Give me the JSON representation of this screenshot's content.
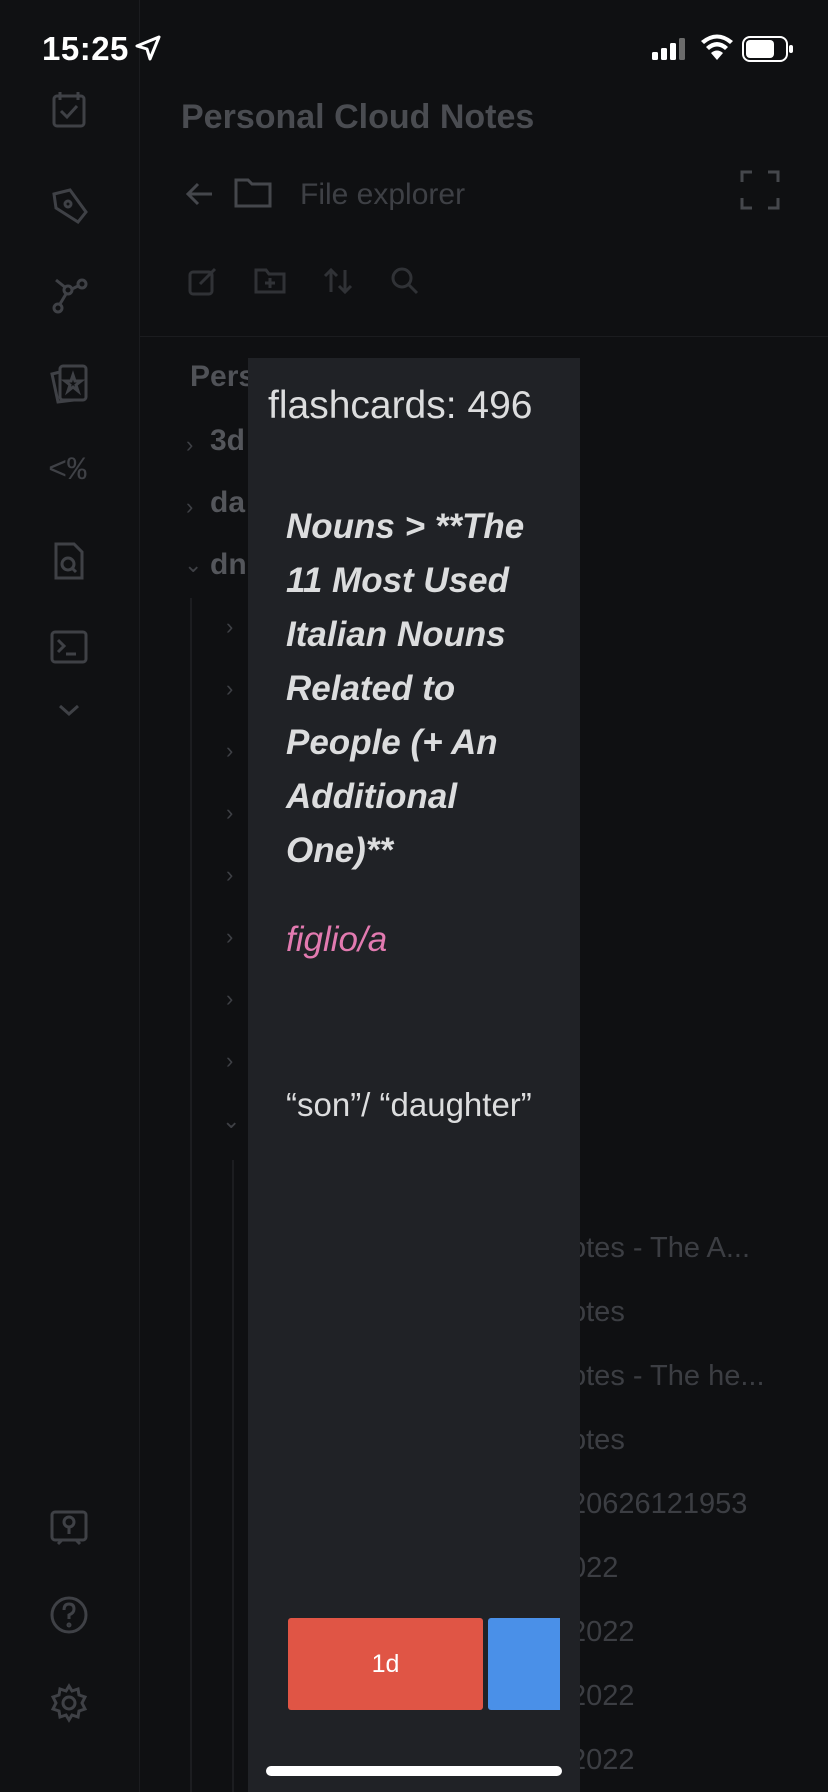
{
  "status_bar": {
    "time": "15:25"
  },
  "explorer": {
    "vault_title": "Personal Cloud Notes",
    "nav_label": "File explorer",
    "tree_root": "Pers",
    "tree_items": [
      "3d",
      "da",
      "dn"
    ],
    "file_rows": [
      "otes - The A...",
      "otes",
      "otes - The he...",
      "otes",
      "20626121953",
      "022",
      "2022",
      "2022",
      "2022"
    ]
  },
  "modal": {
    "title": "flashcards: 496",
    "question": "Nouns > **The 11 Most Used Italian Nouns Related to People (+ An Additional One)**",
    "answer_term": "figlio/a",
    "answer_meaning": "“son”/ “daughter”",
    "buttons": {
      "hard_label": "1d",
      "good_label": ""
    }
  },
  "colors": {
    "accent_red": "#e05545",
    "accent_blue": "#4a90e8",
    "answer_pink": "#e27ab0",
    "modal_bg": "#202226"
  }
}
